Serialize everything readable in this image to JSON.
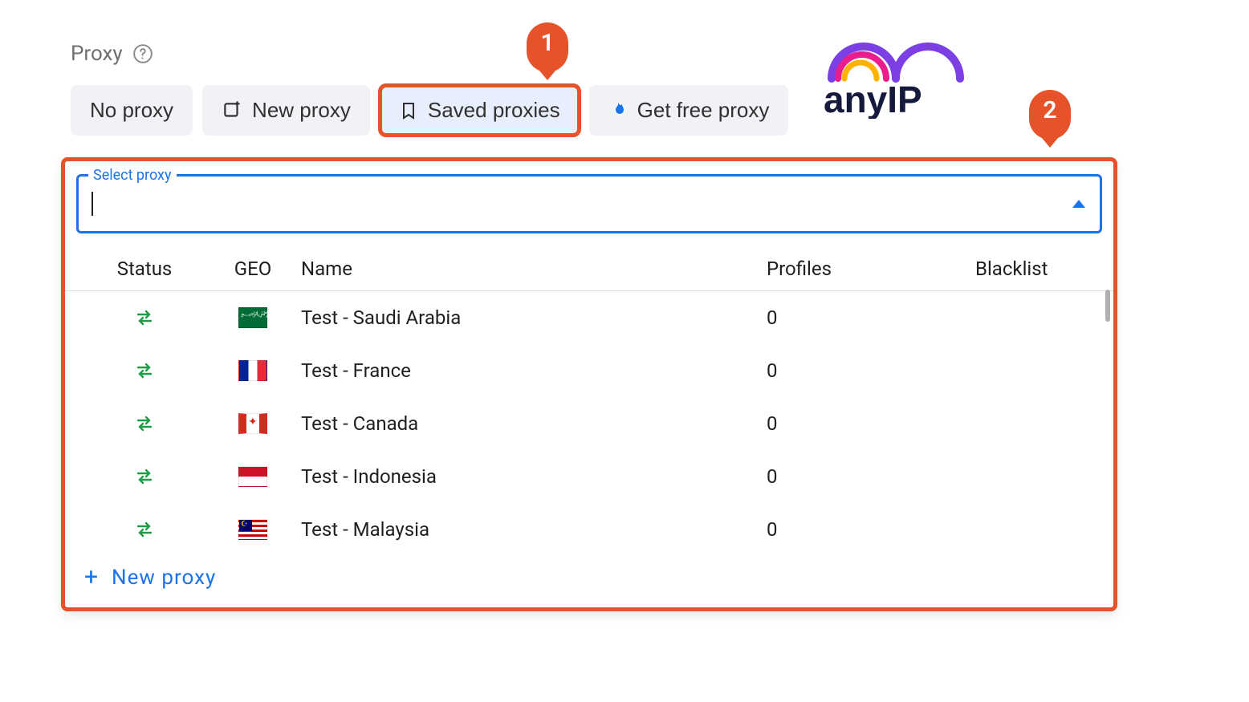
{
  "header": {
    "label": "Proxy"
  },
  "tabs": {
    "no_proxy": "No proxy",
    "new_proxy": "New proxy",
    "saved_proxies": "Saved proxies",
    "get_free_proxy": "Get free proxy"
  },
  "callouts": {
    "one": "1",
    "two": "2"
  },
  "brand": {
    "name": "anyIP"
  },
  "select": {
    "legend": "Select proxy"
  },
  "columns": {
    "status": "Status",
    "geo": "GEO",
    "name": "Name",
    "profiles": "Profiles",
    "blacklist": "Blacklist"
  },
  "rows": [
    {
      "geo": "sa",
      "name": "Test - Saudi Arabia",
      "profiles": "0",
      "blacklist": ""
    },
    {
      "geo": "fr",
      "name": "Test - France",
      "profiles": "0",
      "blacklist": ""
    },
    {
      "geo": "ca",
      "name": "Test - Canada",
      "profiles": "0",
      "blacklist": ""
    },
    {
      "geo": "id",
      "name": "Test - Indonesia",
      "profiles": "0",
      "blacklist": ""
    },
    {
      "geo": "my",
      "name": "Test - Malaysia",
      "profiles": "0",
      "blacklist": ""
    }
  ],
  "footer": {
    "new_proxy": "New proxy"
  }
}
